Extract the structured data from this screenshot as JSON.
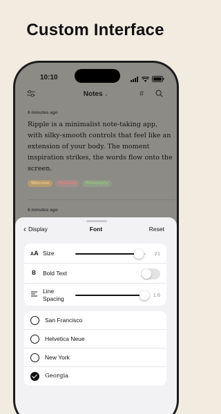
{
  "headline": "Custom Interface",
  "status_bar": {
    "time": "10:10"
  },
  "app_header": {
    "title": "Notes",
    "title_chevron": "⌄"
  },
  "notes": [
    {
      "time": "6 minutes ago",
      "body": "Ripple is a minimalist note-taking app, with silky-smooth controls that feel like an extension of your body. The moment inspiration strikes, the words flow onto the screen.",
      "tags": [
        "Welcome",
        "Features",
        "Philosophy"
      ]
    },
    {
      "time": "6 minutes ago"
    }
  ],
  "sheet": {
    "back_label": "Display",
    "title": "Font",
    "reset_label": "Reset",
    "settings": {
      "size": {
        "icon": "AA",
        "label": "Size",
        "value": "21",
        "fraction": 0.9
      },
      "bold": {
        "icon": "B",
        "label": "Bold Text",
        "on": false
      },
      "line_spacing": {
        "label_line1": "Line",
        "label_line2": "Spacing",
        "value": "1.6",
        "fraction": 0.98
      }
    },
    "fonts": [
      {
        "name": "San Francisco",
        "selected": false
      },
      {
        "name": "Helvetica Neue",
        "selected": false
      },
      {
        "name": "New York",
        "selected": false
      },
      {
        "name": "Georgia",
        "selected": true
      }
    ]
  },
  "colors": {
    "tag_welcome_bg": "#c9a873",
    "tag_welcome_fg": "#e0c282",
    "tag_features_bg": "#b39a95",
    "tag_features_fg": "#d4807f",
    "tag_philosophy_bg": "#9fae93",
    "tag_philosophy_fg": "#86b877"
  }
}
